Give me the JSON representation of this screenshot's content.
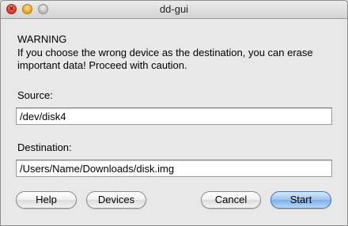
{
  "window": {
    "title": "dd-gui"
  },
  "titlebar": {
    "close_icon": "close-icon",
    "minimize_icon": "minimize-icon",
    "zoom_icon": "zoom-icon",
    "close_glyph": "×"
  },
  "warning": {
    "heading": "WARNING",
    "text": "If you choose the wrong device as the destination, you can erase important data! Proceed with caution."
  },
  "source": {
    "label": "Source:",
    "value": "/dev/disk4"
  },
  "destination": {
    "label": "Destination:",
    "value": "/Users/Name/Downloads/disk.img"
  },
  "buttons": {
    "help": "Help",
    "devices": "Devices",
    "cancel": "Cancel",
    "start": "Start"
  },
  "colors": {
    "default_button": "#7ab0ea",
    "window_bg": "#e8e8e8"
  }
}
